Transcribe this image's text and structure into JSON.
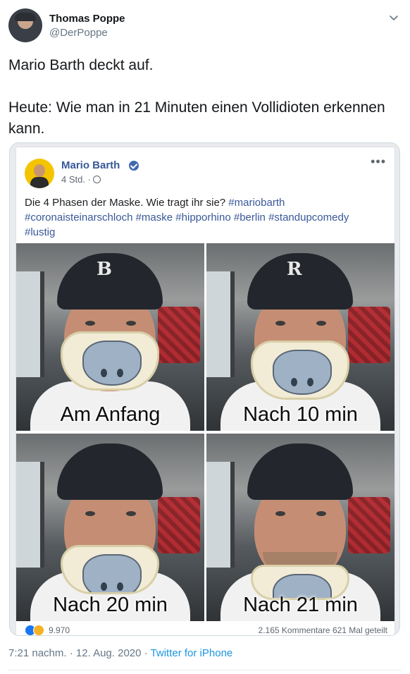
{
  "tweet": {
    "author_name": "Thomas Poppe",
    "author_handle": "@DerPoppe",
    "text": "Mario Barth deckt auf.\n\nHeute: Wie man in 21 Minuten einen Vollidioten erkennen kann.",
    "timestamp": "7:21 nachm. · 12. Aug. 2020 · ",
    "source": "Twitter for iPhone"
  },
  "embed": {
    "page_name": "Mario Barth",
    "meta": "4 Std. ·",
    "more_label": "•••",
    "post_text_plain": "Die 4 Phasen der Maske. Wie tragt ihr sie? ",
    "hashtags": [
      "#mariobarth",
      "#coronaisteinarschloch",
      "#maske",
      "#hipporhino",
      "#berlin",
      "#standupcomedy",
      "#lustig"
    ],
    "panels": [
      {
        "caption": "Am Anfang"
      },
      {
        "caption": "Nach 10 min"
      },
      {
        "caption": "Nach 20 min"
      },
      {
        "caption": "Nach 21 min"
      }
    ],
    "reaction_count": "9.970",
    "stats": "2.165 Kommentare 621 Mal geteilt"
  },
  "colors": {
    "fb_link": "#385898",
    "twitter_link": "#1b95e0",
    "secondary_text": "#657786"
  },
  "icons": {
    "caret": "chevron-down-icon",
    "verified": "verified-badge-icon",
    "globe": "globe-icon",
    "more": "more-dots-icon"
  }
}
